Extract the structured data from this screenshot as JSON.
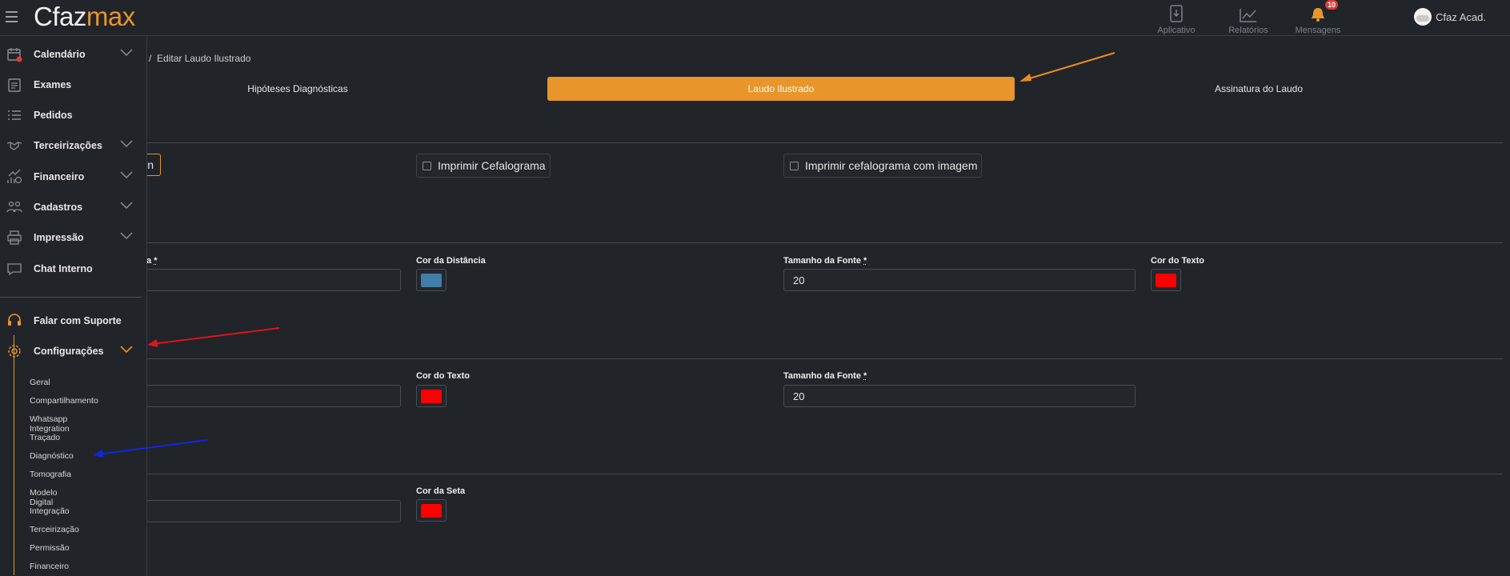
{
  "brand": {
    "part1": "Cfaz",
    "part2": "max"
  },
  "topnav": {
    "aplicativo": "Aplicativo",
    "relatorios": "Relatórios",
    "mensagens": "Mensagens",
    "mensagens_badge": "10"
  },
  "user": {
    "name": "Cfaz Acad."
  },
  "sidebar": {
    "items": [
      {
        "label": "Calendário",
        "icon": "calendar-icon"
      },
      {
        "label": "Exames",
        "icon": "clipboard-icon"
      },
      {
        "label": "Pedidos",
        "icon": "list-icon"
      },
      {
        "label": "Terceirizações",
        "icon": "handshake-icon"
      },
      {
        "label": "Financeiro",
        "icon": "finance-icon"
      },
      {
        "label": "Cadastros",
        "icon": "users-icon"
      },
      {
        "label": "Impressão",
        "icon": "printer-icon"
      },
      {
        "label": "Chat Interno",
        "icon": "chat-icon"
      },
      {
        "label": "Falar com Suporte",
        "icon": "headset-icon"
      },
      {
        "label": "Configurações",
        "icon": "gear-icon"
      }
    ],
    "submenu": [
      "Geral",
      "Compartilhamento",
      "Whatsapp Integration",
      "Traçado",
      "Diagnóstico",
      "Tomografia",
      "Modelo Digital",
      "Integração",
      "Terceirização",
      "Permissão",
      "Financeiro"
    ]
  },
  "breadcrumb": {
    "separator": "/",
    "current": "Editar Laudo Ilustrado"
  },
  "tabs": [
    "Hipóteses Diagnósticas",
    "Laudo Ilustrado",
    "Assinatura do Laudo"
  ],
  "section1": {
    "partial_button": "n",
    "checkbox1": "Imprimir Cefalograma",
    "checkbox2": "Imprimir cefalograma com imagem"
  },
  "section2": {
    "label_partial": "a",
    "cor_distancia": "Cor da Distância",
    "tamanho_fonte": "Tamanho da Fonte",
    "tamanho_fonte_value": "20",
    "cor_texto": "Cor do Texto"
  },
  "section3": {
    "cor_texto": "Cor do Texto",
    "tamanho_fonte": "Tamanho da Fonte",
    "tamanho_fonte_value": "20"
  },
  "section4": {
    "cor_seta": "Cor da Seta"
  },
  "required_mark": "*",
  "colors": {
    "accent": "#e8952a",
    "distance_swatch": "#3f7fa8",
    "text_swatch": "#ff0000",
    "arrow_swatch": "#ff0000",
    "annotation_orange": "#f08a1e",
    "annotation_red": "#e0141e",
    "annotation_blue": "#1424e6"
  }
}
